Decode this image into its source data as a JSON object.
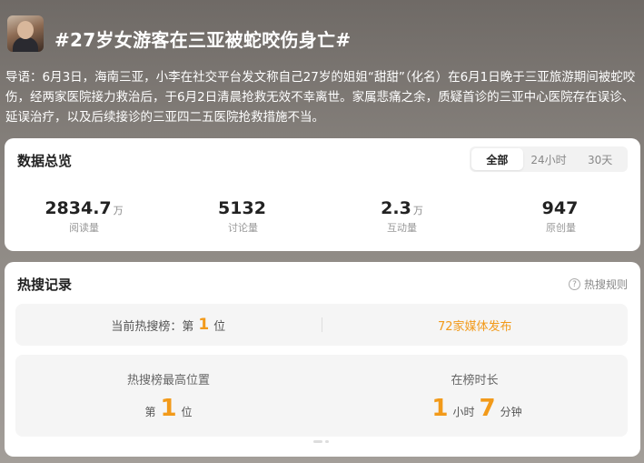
{
  "header": {
    "title": "#27岁女游客在三亚被蛇咬伤身亡#"
  },
  "intro": {
    "text": "导语：6月3日，海南三亚，小李在社交平台发文称自己27岁的姐姐“甜甜”（化名）在6月1日晚于三亚旅游期间被蛇咬伤，经两家医院接力救治后，于6月2日清晨抢救无效不幸离世。家属悲痛之余，质疑首诊的三亚中心医院存在误诊、延误治疗，以及后续接诊的三亚四二五医院抢救措施不当。"
  },
  "overview": {
    "title": "数据总览",
    "tabs": [
      {
        "label": "全部",
        "active": true
      },
      {
        "label": "24小时",
        "active": false
      },
      {
        "label": "30天",
        "active": false
      }
    ],
    "stats": [
      {
        "value": "2834.7",
        "unit": "万",
        "label": "阅读量"
      },
      {
        "value": "5132",
        "unit": "",
        "label": "讨论量"
      },
      {
        "value": "2.3",
        "unit": "万",
        "label": "互动量"
      },
      {
        "value": "947",
        "unit": "",
        "label": "原创量"
      }
    ]
  },
  "hot": {
    "title": "热搜记录",
    "rules_label": "热搜规则",
    "current_prefix": "当前热搜榜：第",
    "current_rank": "1",
    "current_suffix": "位",
    "media_label": "72家媒体发布",
    "peak_label": "热搜榜最高位置",
    "peak_prefix": "第",
    "peak_rank": "1",
    "peak_suffix": "位",
    "duration_label": "在榜时长",
    "duration_hours": "1",
    "hours_unit": "小时",
    "duration_minutes": "7",
    "minutes_unit": "分钟"
  },
  "colors": {
    "accent": "#f29a1a",
    "card_bg": "#ffffff",
    "panel_bg": "#f5f5f5"
  },
  "icons": {
    "help": "question-circle-icon"
  }
}
